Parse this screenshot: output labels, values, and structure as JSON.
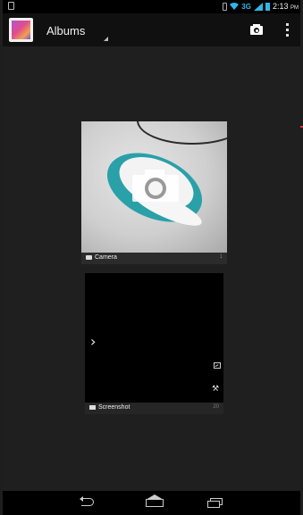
{
  "status_bar": {
    "network": "3G",
    "time": "2:13",
    "ampm": "PM",
    "accent_color": "#33b5e5"
  },
  "action_bar": {
    "app_icon": "gallery-app-icon",
    "title": "Albums",
    "camera_icon": "camera-icon",
    "overflow_icon": "overflow-menu-icon"
  },
  "albums": [
    {
      "name": "Camera",
      "count": "1",
      "icon": "camera-icon"
    },
    {
      "name": "Screenshot",
      "count": "20",
      "icon": "folder-icon"
    }
  ],
  "nav_bar": {
    "back_icon": "back-icon",
    "home_icon": "home-icon",
    "recent_icon": "recent-apps-icon"
  }
}
